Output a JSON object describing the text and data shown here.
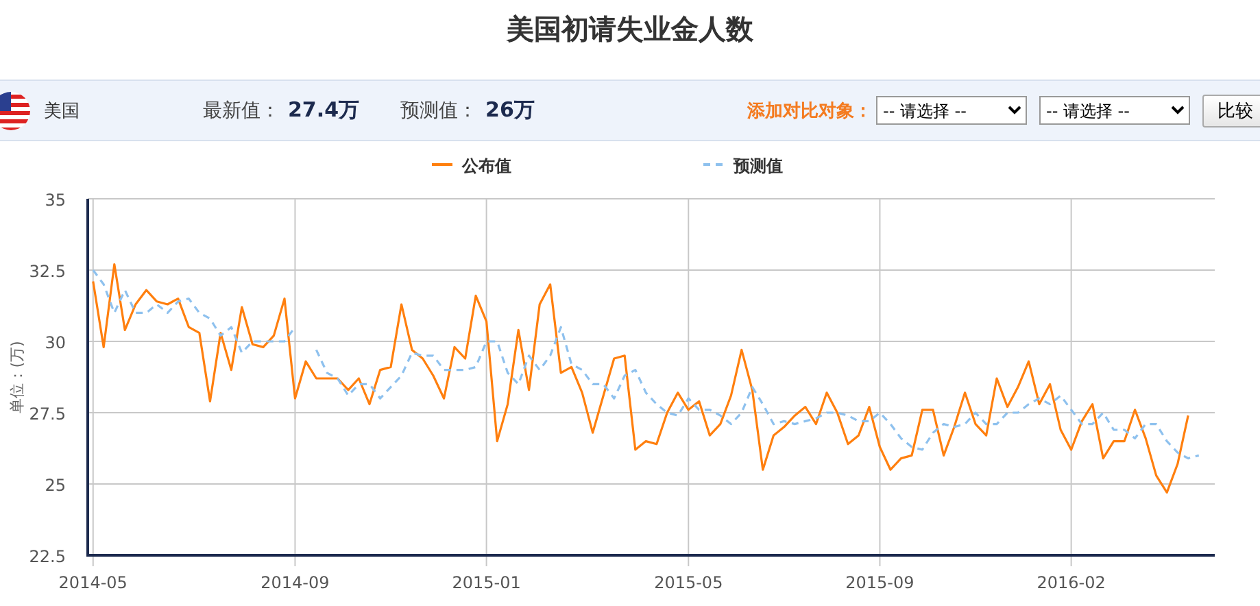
{
  "title": "美国初请失业金人数",
  "toolbar": {
    "country": "美国",
    "latest_label": "最新值：",
    "latest_value": "27.4万",
    "forecast_label": "预测值：",
    "forecast_value": "26万",
    "compare_label": "添加对比对象：",
    "selects": [
      "-- 请选择 --",
      "-- 请选择 --"
    ],
    "button": "比较"
  },
  "chart": {
    "chart_data": {
      "type": "line",
      "ylabel": "单位：(万)",
      "categories": [
        "2014-05",
        null,
        null,
        null,
        null,
        null,
        null,
        null,
        null,
        null,
        null,
        null,
        null,
        null,
        null,
        null,
        null,
        null,
        null,
        "2014-09",
        null,
        null,
        null,
        null,
        null,
        null,
        null,
        null,
        null,
        null,
        null,
        null,
        null,
        null,
        null,
        null,
        null,
        "2015-01",
        null,
        null,
        null,
        null,
        null,
        null,
        null,
        null,
        null,
        null,
        null,
        null,
        null,
        null,
        null,
        null,
        null,
        null,
        "2015-05",
        null,
        null,
        null,
        null,
        null,
        null,
        null,
        null,
        null,
        null,
        null,
        null,
        null,
        null,
        null,
        null,
        null,
        "2015-09",
        null,
        null,
        null,
        null,
        null,
        null,
        null,
        null,
        null,
        null,
        null,
        null,
        null,
        null,
        null,
        null,
        null,
        "2016-02",
        null,
        null,
        null,
        null,
        null,
        null,
        null,
        null,
        null,
        null,
        null,
        null
      ],
      "ylim": [
        22.5,
        35
      ],
      "grid": true,
      "legend": true,
      "yticks": [
        22.5,
        25,
        27.5,
        30,
        32.5,
        35
      ],
      "series": [
        {
          "name": "公布值",
          "color": "#ff7f0e",
          "line_style": "solid",
          "values": [
            32.1,
            29.8,
            32.7,
            30.4,
            31.3,
            31.8,
            31.4,
            31.3,
            31.5,
            30.5,
            30.3,
            27.9,
            30.3,
            29.0,
            31.2,
            29.9,
            29.8,
            30.2,
            31.5,
            28.0,
            29.3,
            28.7,
            28.7,
            28.7,
            28.3,
            28.7,
            27.8,
            29.0,
            29.1,
            31.3,
            29.7,
            29.4,
            28.8,
            28.0,
            29.8,
            29.4,
            31.6,
            30.7,
            26.5,
            27.8,
            30.4,
            28.3,
            31.3,
            32.0,
            28.9,
            29.1,
            28.2,
            26.8,
            28.1,
            29.4,
            29.5,
            26.2,
            26.5,
            26.4,
            27.5,
            28.2,
            27.6,
            27.9,
            26.7,
            27.1,
            28.1,
            29.7,
            28.3,
            25.5,
            26.7,
            27.0,
            27.4,
            27.7,
            27.1,
            28.2,
            27.5,
            26.4,
            26.7,
            27.7,
            26.3,
            25.5,
            25.9,
            26.0,
            27.6,
            27.6,
            26.0,
            27.0,
            28.2,
            27.1,
            26.7,
            28.7,
            27.7,
            28.4,
            29.3,
            27.8,
            28.5,
            26.9,
            26.2,
            27.2,
            27.8,
            25.9,
            26.5,
            26.5,
            27.6,
            26.6,
            25.3,
            24.7,
            25.7,
            27.4,
            null
          ]
        },
        {
          "name": "预测值",
          "color": "#8ec1ee",
          "line_style": "dashed",
          "values": [
            32.5,
            32.0,
            31.0,
            31.8,
            31.0,
            31.0,
            31.3,
            31.0,
            31.4,
            31.5,
            31.0,
            30.8,
            30.2,
            30.5,
            29.6,
            30.0,
            30.0,
            30.0,
            30.0,
            30.5,
            null,
            29.7,
            28.9,
            28.7,
            28.1,
            28.5,
            28.5,
            28.0,
            28.4,
            28.8,
            29.6,
            29.5,
            29.5,
            29.0,
            29.0,
            29.0,
            29.1,
            30.0,
            30.0,
            28.9,
            28.5,
            29.5,
            29.0,
            29.5,
            30.5,
            29.2,
            29.0,
            28.5,
            28.5,
            28.0,
            28.8,
            29.0,
            28.2,
            27.8,
            27.5,
            27.4,
            28.0,
            27.6,
            27.6,
            27.4,
            27.1,
            27.5,
            28.4,
            27.8,
            27.1,
            27.2,
            27.1,
            27.2,
            27.3,
            27.5,
            27.5,
            27.4,
            27.2,
            27.2,
            27.5,
            27.1,
            26.6,
            26.3,
            26.2,
            26.8,
            27.1,
            27.0,
            27.1,
            27.5,
            27.1,
            27.1,
            27.5,
            27.5,
            27.8,
            28.0,
            27.8,
            28.1,
            27.6,
            27.1,
            27.1,
            27.5,
            26.9,
            26.9,
            26.6,
            27.1,
            27.1,
            26.5,
            26.1,
            25.9,
            26.0
          ]
        }
      ]
    }
  }
}
